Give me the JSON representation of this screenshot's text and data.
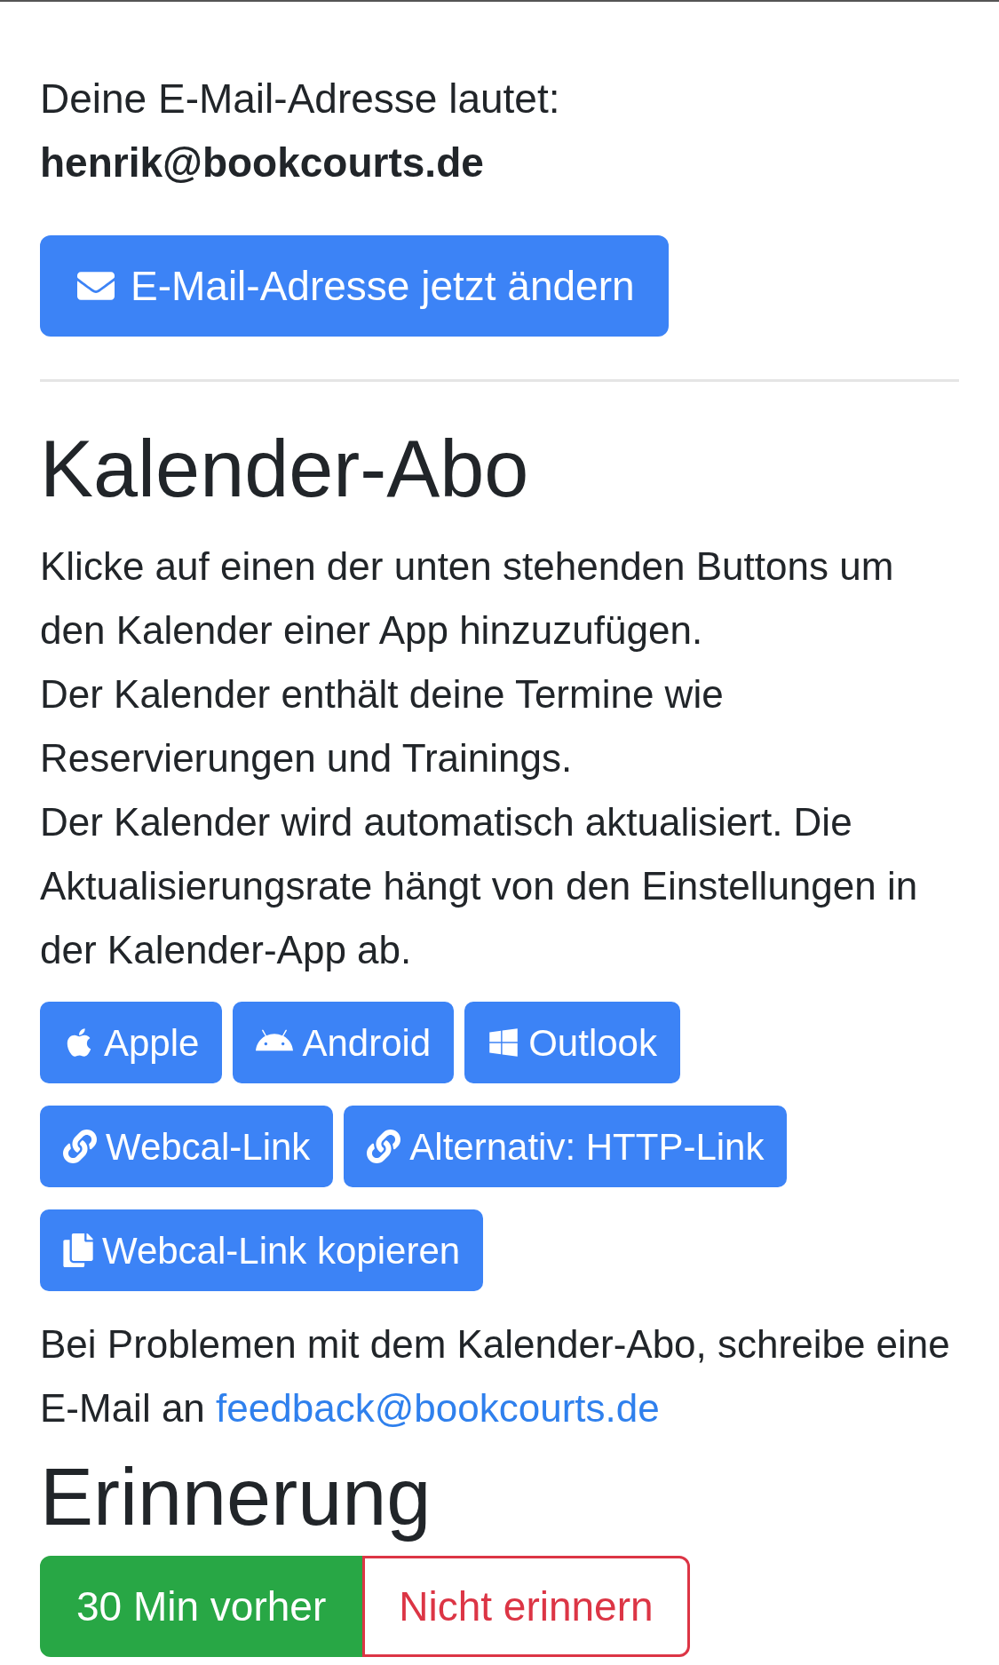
{
  "email_section": {
    "intro": "Deine E-Mail-Adresse lautet:",
    "address": "henrik@bookcourts.de",
    "change_button": "E-Mail-Adresse jetzt ändern"
  },
  "calendar": {
    "heading": "Kalender-Abo",
    "paragraphs": [
      "Klicke auf einen der unten stehenden Buttons um den Kalender einer App hinzuzufügen.",
      "Der Kalender enthält deine Termine wie Reservierungen und Trainings.",
      "Der Kalender wird automatisch aktualisiert. Die Aktualisierungsrate hängt von den Einstellungen in der Kalender-App ab."
    ],
    "buttons": [
      {
        "kind": "apple",
        "label": "Apple"
      },
      {
        "kind": "android",
        "label": "Android"
      },
      {
        "kind": "windows",
        "label": "Outlook"
      },
      {
        "kind": "link",
        "label": "Webcal-Link"
      },
      {
        "kind": "link",
        "label": "Alternativ: HTTP-Link"
      },
      {
        "kind": "copy",
        "label": "Webcal-Link kopieren"
      }
    ],
    "help_text": "Bei Problemen mit dem Kalender-Abo, schreibe eine E-Mail an",
    "help_link": "feedback@bookcourts.de"
  },
  "reminder": {
    "heading": "Erinnerung",
    "options": [
      {
        "label": "30 Min vorher",
        "selected": true
      },
      {
        "label": "Nicht erinnern",
        "selected": false
      }
    ]
  }
}
